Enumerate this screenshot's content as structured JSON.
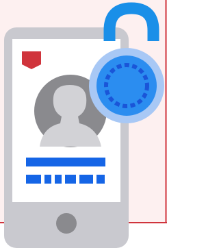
{
  "illustration": {
    "subject": "phone-profile-with-padlock",
    "colors": {
      "background": "#ffffff",
      "card_fill": "#fdf0f0",
      "card_border": "#d0343c",
      "phone_body": "#c9c9cf",
      "phone_screen": "#ffffff",
      "home_button": "#8a8a8e",
      "bookmark": "#d0343c",
      "avatar_disc": "#8a8a8e",
      "avatar_silhouette": "#d2d2d6",
      "name_bar": "#1565e6",
      "password_dashes": "#1565e6",
      "lock_shackle": "#1a8fe8",
      "lock_ring_outer": "#a8c8f5",
      "lock_body": "#2b8df0",
      "lock_dial": "#1a55d8"
    },
    "icons": [
      "phone-icon",
      "bookmark-icon",
      "avatar-icon",
      "padlock-icon"
    ],
    "password_dash_count": 6
  }
}
